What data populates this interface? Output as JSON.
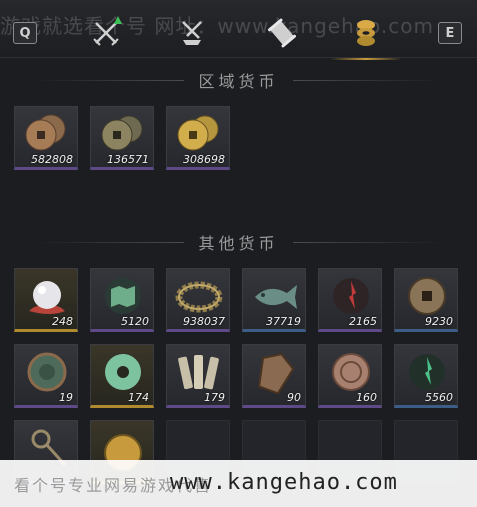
{
  "header": {
    "key_left": "Q",
    "key_right": "E",
    "watermark": "游戏就选看个号 网址：www.kangehao.com"
  },
  "sections": {
    "regional": "区域货币",
    "other": "其他货币"
  },
  "regional_items": [
    {
      "icon": "copper-coins-icon",
      "count": "582808"
    },
    {
      "icon": "bronze-coins-icon",
      "count": "136571"
    },
    {
      "icon": "gold-coins-icon",
      "count": "308698"
    }
  ],
  "other_items": [
    {
      "icon": "pearl-icon",
      "count": "248"
    },
    {
      "icon": "jade-map-icon",
      "count": "5120"
    },
    {
      "icon": "bead-bracelet-icon",
      "count": "938037"
    },
    {
      "icon": "jade-fish-icon",
      "count": "37719"
    },
    {
      "icon": "red-crystal-icon",
      "count": "2165"
    },
    {
      "icon": "ancient-coin-icon",
      "count": "9230"
    },
    {
      "icon": "green-seal-icon",
      "count": "19"
    },
    {
      "icon": "jade-disc-icon",
      "count": "174"
    },
    {
      "icon": "bamboo-slips-icon",
      "count": "179"
    },
    {
      "icon": "bronze-token-icon",
      "count": "90"
    },
    {
      "icon": "stone-seal-icon",
      "count": "160"
    },
    {
      "icon": "green-crystal-icon",
      "count": "5560"
    }
  ],
  "footer": {
    "cn_text": "看个号专业网易游戏代售",
    "url": "www.kangehao.com"
  },
  "colors": {
    "accent": "#c79b3d",
    "rarity_purple": "#5e4a86",
    "rarity_gold": "#b08a2e",
    "rarity_blue": "#3d5c86"
  }
}
